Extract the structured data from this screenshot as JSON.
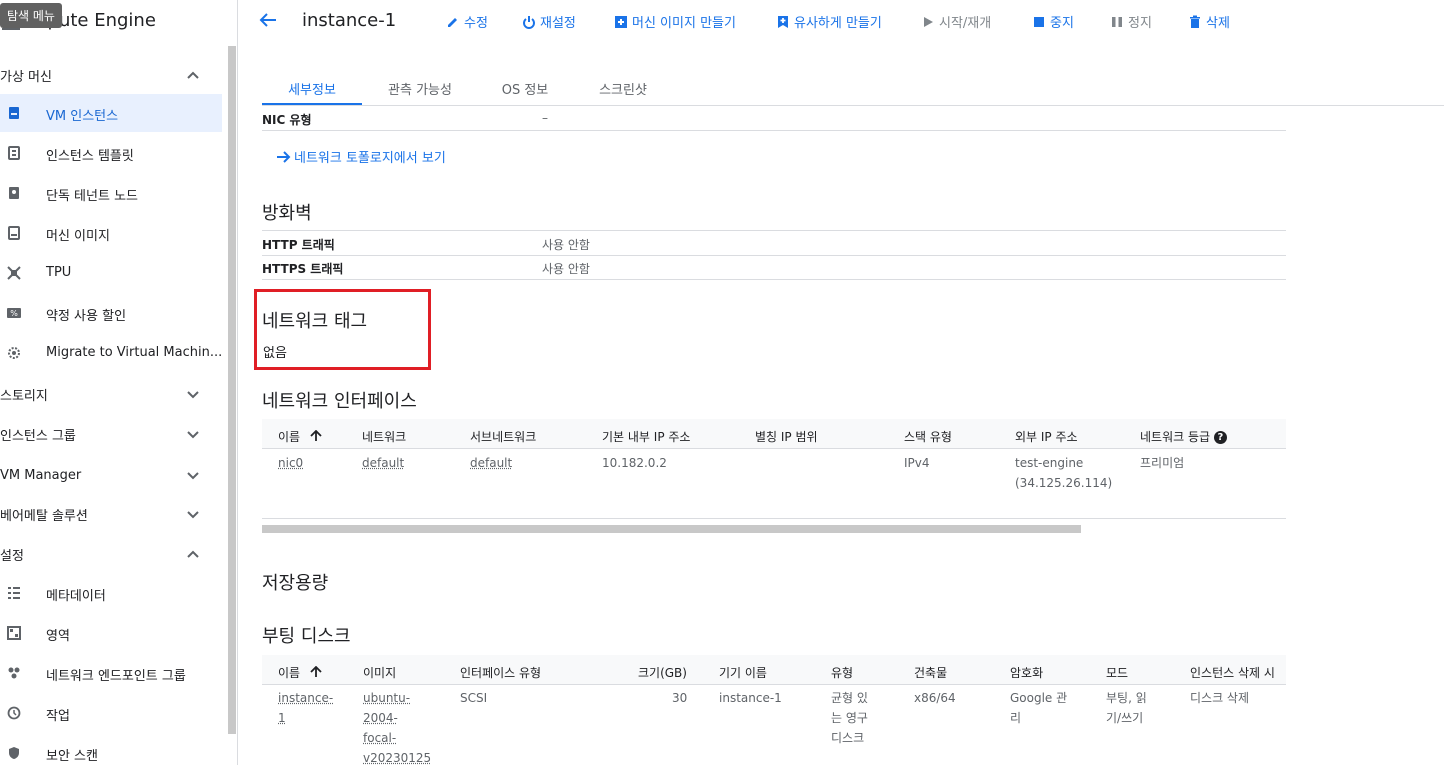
{
  "sidebar": {
    "tooltip": "탐색 메뉴",
    "title": "mpute Engine",
    "sections": [
      {
        "label": "가상 머신",
        "expanded": true
      },
      {
        "label": "스토리지",
        "expanded": false
      },
      {
        "label": "인스턴스 그룹",
        "expanded": false
      },
      {
        "label": "VM Manager",
        "expanded": false
      },
      {
        "label": "베어메탈 솔루션",
        "expanded": false
      },
      {
        "label": "설정",
        "expanded": true
      }
    ],
    "vm_items": [
      "VM 인스턴스",
      "인스턴스 템플릿",
      "단독 테넌트 노드",
      "머신 이미지",
      "TPU",
      "약정 사용 할인",
      "Migrate to Virtual Machin..."
    ],
    "settings_items": [
      "메타데이터",
      "영역",
      "네트워크 엔드포인트 그룹",
      "작업",
      "보안 스캔"
    ]
  },
  "topbar": {
    "title": "instance-1",
    "buttons": [
      "수정",
      "재설정",
      "머신 이미지 만들기",
      "유사하게 만들기",
      "시작/재개",
      "중지",
      "정지",
      "삭제"
    ]
  },
  "tabs": [
    "세부정보",
    "관측 가능성",
    "OS 정보",
    "스크린샷"
  ],
  "nic": {
    "key": "NIC 유형",
    "value": "–"
  },
  "topology_link": "네트워크 토폴로지에서 보기",
  "firewall": {
    "title": "방화벽",
    "rows": [
      {
        "key": "HTTP 트래픽",
        "value": "사용 안함"
      },
      {
        "key": "HTTPS 트래픽",
        "value": "사용 안함"
      }
    ]
  },
  "network_tags": {
    "title": "네트워크 태그",
    "value": "없음"
  },
  "interfaces": {
    "title": "네트워크 인터페이스",
    "headers": [
      "이름",
      "네트워크",
      "서브네트워크",
      "기본 내부 IP 주소",
      "별칭 IP 범위",
      "스택 유형",
      "외부 IP 주소",
      "네트워크 등급"
    ],
    "row": {
      "name": "nic0",
      "network": "default",
      "subnet": "default",
      "internal_ip": "10.182.0.2",
      "alias": "",
      "stack": "IPv4",
      "external_ip_1": "test-engine",
      "external_ip_2": "(34.125.26.114)",
      "tier": "프리미엄"
    }
  },
  "storage": {
    "title": "저장용량"
  },
  "boot_disk": {
    "title": "부팅 디스크",
    "headers": [
      "이름",
      "이미지",
      "인터페이스 유형",
      "크기(GB)",
      "기기 이름",
      "유형",
      "건축물",
      "암호화",
      "모드",
      "인스턴스 삭제 시"
    ],
    "row": {
      "name_1": "instance-",
      "name_2": "1",
      "image": [
        "ubuntu-",
        "2004-",
        "focal-",
        "v20230125"
      ],
      "iface": "SCSI",
      "size": "30",
      "device": "instance-1",
      "type": [
        "균형 있",
        "는 영구",
        "디스크"
      ],
      "arch": "x86/64",
      "enc": [
        "Google 관",
        "리"
      ],
      "mode": [
        "부팅, 읽",
        "기/쓰기"
      ],
      "on_delete": "디스크 삭제"
    }
  },
  "colors": {
    "accent": "#1a73e8",
    "highlight_box": "#e01e25",
    "active_bg": "#e8f0fe"
  }
}
